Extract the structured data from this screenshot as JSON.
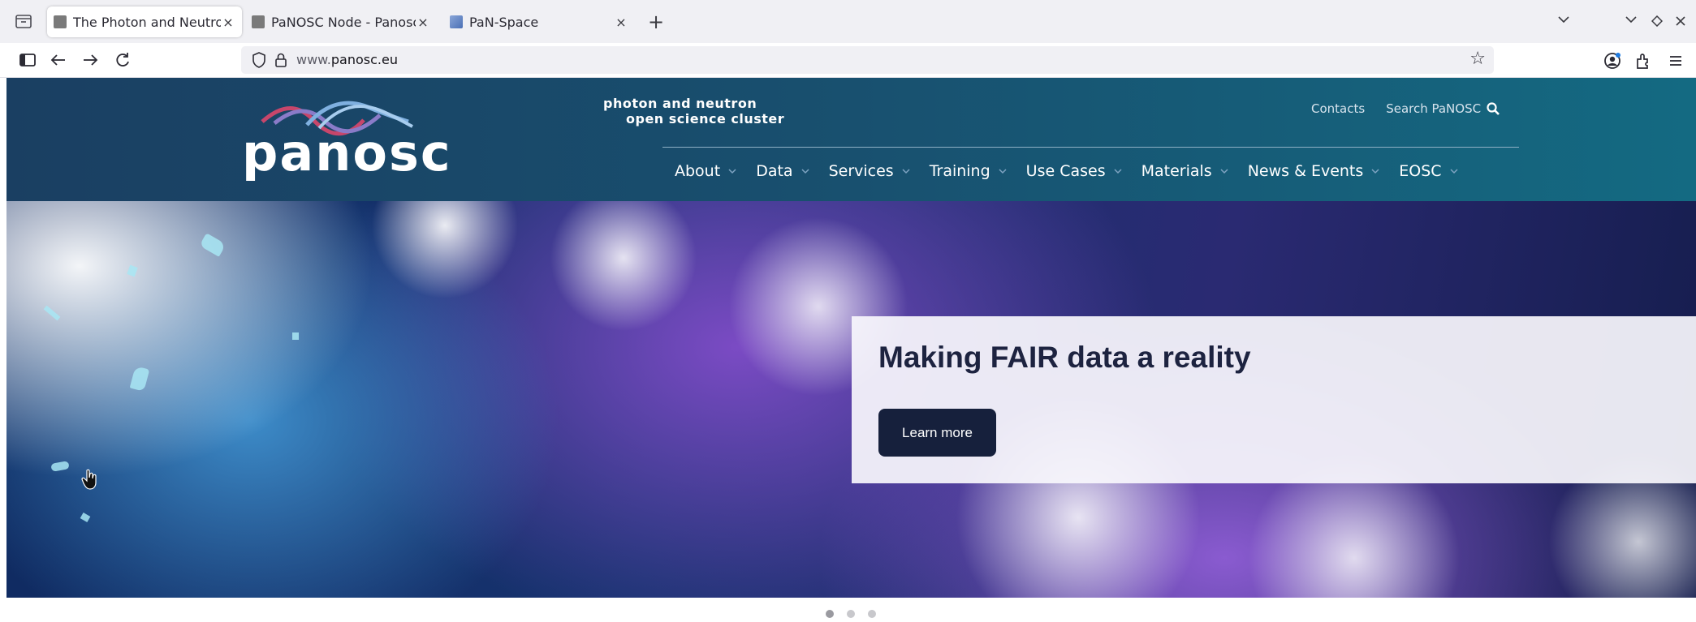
{
  "browser": {
    "tabs": [
      {
        "title": "The Photon and Neutron Open Science Cluster",
        "active": true,
        "favicon_color": "#777777"
      },
      {
        "title": "PaNOSC Node - Panosc",
        "active": false,
        "favicon_color": "#777777"
      },
      {
        "title": "PaN-Space",
        "active": false,
        "favicon_color": "#4a6fb5"
      }
    ],
    "new_tab_label": "+",
    "close_glyph": "×",
    "url_prefix": "www.",
    "url_domain": "panosc.eu"
  },
  "site": {
    "logo_text": "panosc",
    "tagline_line1": "photon and neutron",
    "tagline_line2": "open science cluster",
    "top_links": {
      "contacts": "Contacts",
      "search": "Search PaNOSC"
    },
    "nav": [
      {
        "label": "About"
      },
      {
        "label": "Data"
      },
      {
        "label": "Services"
      },
      {
        "label": "Training"
      },
      {
        "label": "Use Cases"
      },
      {
        "label": "Materials"
      },
      {
        "label": "News & Events"
      },
      {
        "label": "EOSC"
      }
    ],
    "header_colors": {
      "left": "#1a3f62",
      "right": "#146a82"
    }
  },
  "hero": {
    "title": "Making FAIR data a reality",
    "button_label": "Learn more",
    "slides_total": 3,
    "active_slide": 1
  }
}
